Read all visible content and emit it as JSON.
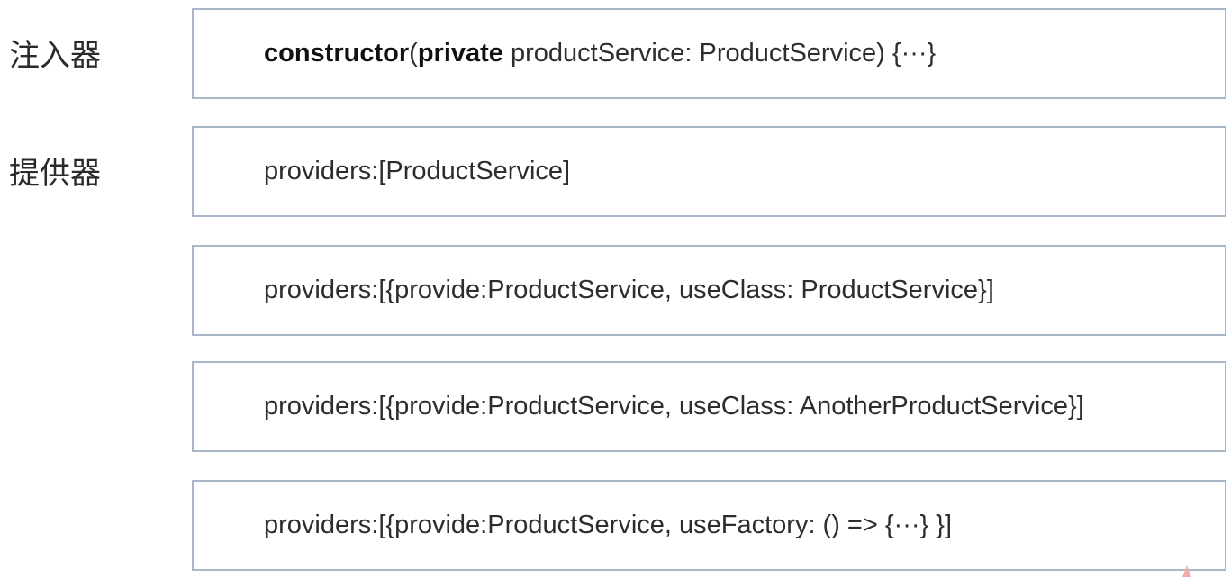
{
  "labels": {
    "injector": "注入器",
    "provider": "提供器"
  },
  "injector_box": {
    "kw_constructor": "constructor",
    "paren_open": "(",
    "kw_private": "private",
    "rest": " productService: ProductService) {···}"
  },
  "provider_boxes": [
    {
      "code": "providers:[ProductService]"
    },
    {
      "code": "providers:[{provide:ProductService, useClass: ProductService}]"
    },
    {
      "code": "providers:[{provide:ProductService, useClass: AnotherProductService}]"
    },
    {
      "code": "providers:[{provide:ProductService, useFactory: () => {···} }]"
    }
  ]
}
